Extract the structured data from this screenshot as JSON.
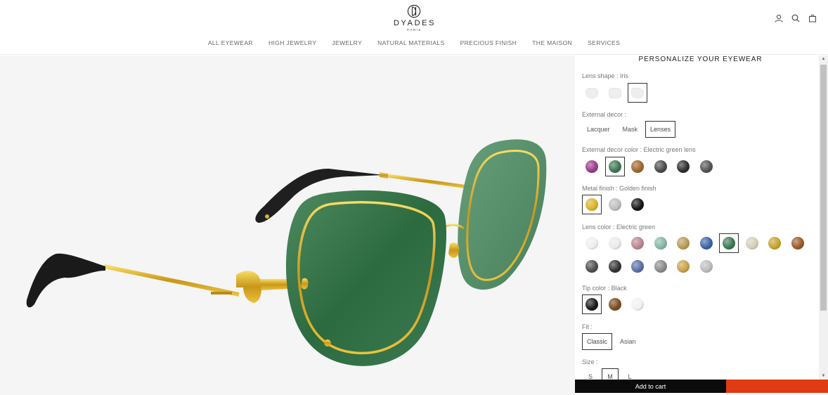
{
  "brand": {
    "name": "DYADES",
    "subtitle": "PARIS"
  },
  "header_icons": [
    "account-icon",
    "search-icon",
    "bag-icon"
  ],
  "nav": [
    {
      "label": "ALL EYEWEAR"
    },
    {
      "label": "HIGH JEWELRY"
    },
    {
      "label": "JEWELRY"
    },
    {
      "label": "NATURAL MATERIALS"
    },
    {
      "label": "PRECIOUS FINISH"
    },
    {
      "label": "THE MAISON"
    },
    {
      "label": "SERVICES"
    }
  ],
  "configurator": {
    "title": "PERSONALIZE YOUR EYEWEAR",
    "lens_shape": {
      "label": "Lens shape : Iris",
      "options": [
        "shape-1",
        "shape-2",
        "shape-3"
      ],
      "selected": 2
    },
    "external_decor": {
      "label": "External decor :",
      "options": [
        "Lacquer",
        "Mask",
        "Lenses"
      ],
      "selected": 2
    },
    "external_decor_color": {
      "label": "External decor color : Electric green lens",
      "colors": [
        "#9a3b86",
        "#3c7752",
        "#a0642e",
        "#4a4a4a",
        "#2e2e2e",
        "#545454"
      ],
      "selected": 1
    },
    "metal_finish": {
      "label": "Metal finish : Golden finish",
      "colors": [
        "#d9b328",
        "#bdbdbd",
        "#161616"
      ],
      "selected": 0
    },
    "lens_color": {
      "label": "Lens color : Electric green",
      "colors_row1": [
        "#efefef",
        "#eaeaea",
        "#b8868e",
        "#86b5a6",
        "#b89a56",
        "#3c63a3",
        "#3c7752",
        "#d2cfb7",
        "#c3a32c",
        "#9a5a2a"
      ],
      "colors_row2": [
        "#4e4e4e",
        "#333333",
        "#5b6ea6",
        "#8a8a8a",
        "#c8a04a",
        "#bcbcbc"
      ],
      "selected_row1": 6
    },
    "tip_color": {
      "label": "Tip color : Black",
      "colors": [
        "#1a1a1a",
        "#7a4a1e",
        "#f0f0f0"
      ],
      "selected": 0
    },
    "fit": {
      "label": "Fit :",
      "options": [
        "Classic",
        "Asian"
      ],
      "selected": 0
    },
    "size": {
      "label": "Size :",
      "options": [
        "S",
        "M",
        "L"
      ],
      "selected": 1
    }
  },
  "cta": {
    "add_to_cart": "Add to cart"
  }
}
